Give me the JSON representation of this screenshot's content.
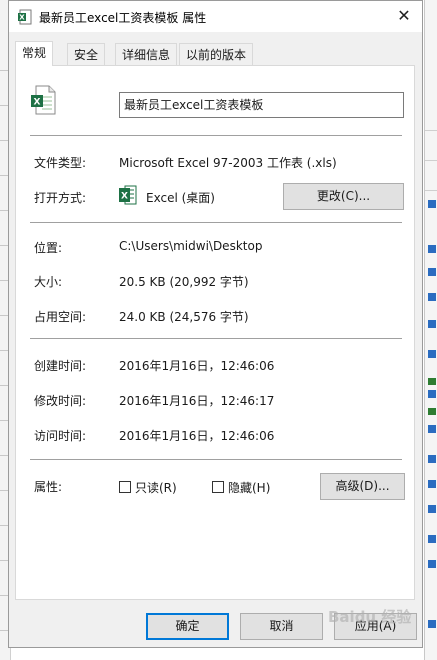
{
  "window": {
    "title": "最新员工excel工资表模板 属性",
    "close_glyph": "✕"
  },
  "tabs": [
    {
      "label": "常规"
    },
    {
      "label": "安全"
    },
    {
      "label": "详细信息"
    },
    {
      "label": "以前的版本"
    }
  ],
  "general": {
    "file_name": "最新员工excel工资表模板",
    "file_type_label": "文件类型:",
    "file_type_value": "Microsoft Excel 97-2003 工作表 (.xls)",
    "open_with_label": "打开方式:",
    "open_with_value": "Excel (桌面)",
    "change_button": "更改(C)...",
    "location_label": "位置:",
    "location_value": "C:\\Users\\midwi\\Desktop",
    "size_label": "大小:",
    "size_value": "20.5 KB (20,992 字节)",
    "size_on_disk_label": "占用空间:",
    "size_on_disk_value": "24.0 KB (24,576 字节)",
    "created_label": "创建时间:",
    "created_value": "2016年1月16日，12:46:06",
    "modified_label": "修改时间:",
    "modified_value": "2016年1月16日，12:46:17",
    "accessed_label": "访问时间:",
    "accessed_value": "2016年1月16日，12:46:06",
    "attributes_label": "属性:",
    "readonly_label": "只读(R)",
    "hidden_label": "隐藏(H)",
    "advanced_button": "高级(D)..."
  },
  "footer": {
    "ok": "确定",
    "cancel": "取消",
    "apply": "应用(A)"
  },
  "watermark": "Baidu 经验",
  "colors": {
    "excel_green": "#1e7145",
    "primary_border": "#0078d7"
  }
}
